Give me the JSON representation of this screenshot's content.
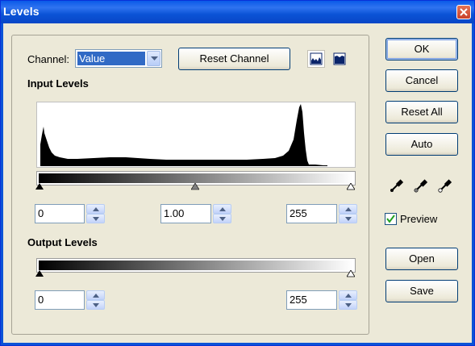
{
  "window": {
    "title": "Levels"
  },
  "channel": {
    "label": "Channel:",
    "value": "Value"
  },
  "buttons": {
    "reset_channel": "Reset Channel",
    "ok": "OK",
    "cancel": "Cancel",
    "reset_all": "Reset All",
    "auto": "Auto",
    "open": "Open",
    "save": "Save"
  },
  "input_levels": {
    "heading": "Input Levels",
    "black": "0",
    "gamma": "1.00",
    "white": "255"
  },
  "output_levels": {
    "heading": "Output Levels",
    "black": "0",
    "white": "255"
  },
  "preview": {
    "label": "Preview",
    "checked": true
  },
  "histogram_view": {
    "linear_selected": true,
    "icons": [
      "linear-histogram-icon",
      "logarithmic-histogram-icon"
    ]
  },
  "eyedroppers": [
    "pick-black-point-icon",
    "pick-gray-point-icon",
    "pick-white-point-icon"
  ],
  "colors": {
    "titlebar": "#0b53d6",
    "selection": "#316ac5",
    "face": "#ece9d8"
  }
}
